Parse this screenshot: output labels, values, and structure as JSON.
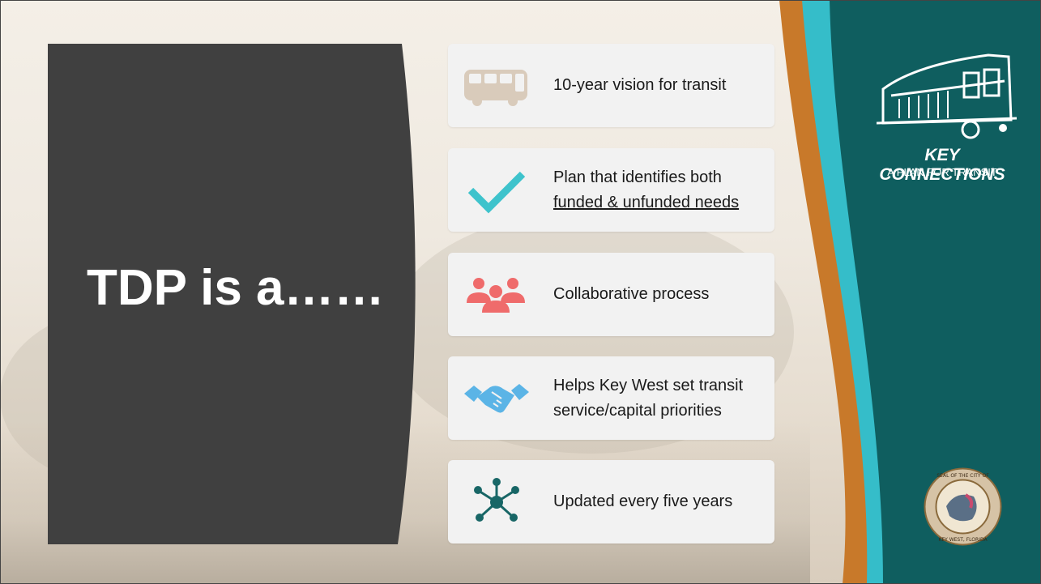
{
  "slide": {
    "title": "TDP is a……",
    "items": [
      {
        "icon": "bus-icon",
        "line1": "10-year vision for transit",
        "line2": "",
        "underline": false
      },
      {
        "icon": "checkmark-icon",
        "line1": "Plan that identifies both",
        "line2": "funded & unfunded needs",
        "underline": true
      },
      {
        "icon": "people-group-icon",
        "line1": "Collaborative process",
        "line2": "",
        "underline": false
      },
      {
        "icon": "handshake-icon",
        "line1": "Helps Key West set transit",
        "line2": "service/capital priorities",
        "underline": false
      },
      {
        "icon": "network-icon",
        "line1": "Updated every five years",
        "line2": "",
        "underline": false
      }
    ]
  },
  "branding": {
    "logo_title": "KEY CONNECTIONS",
    "logo_subtitle": "A PLAN FOR TRANSIT",
    "seal_top_text": "SEAL OF THE CITY OF",
    "seal_bottom_text": "KEY WEST, FLORIDA"
  },
  "colors": {
    "panel": "#404040",
    "teal": "#0f5e5f",
    "turquoise": "#35bdc9",
    "orange": "#c8792a",
    "checkmark": "#3ec3cc",
    "people": "#ef6b6b",
    "handshake": "#5bb4e6",
    "network": "#186666",
    "bus": "#d9cbbb"
  }
}
